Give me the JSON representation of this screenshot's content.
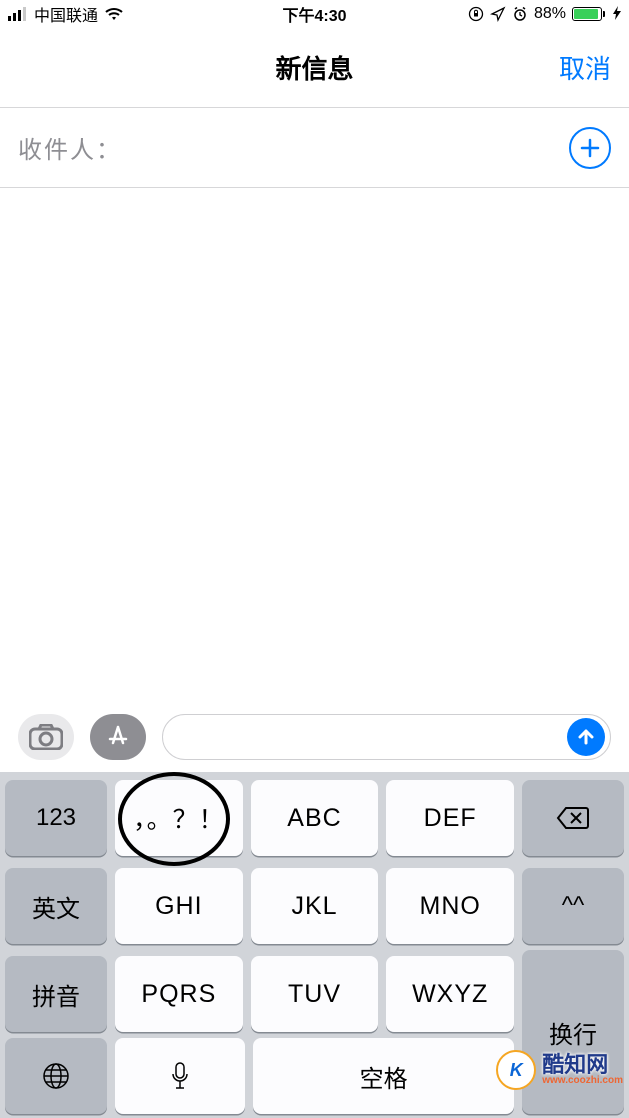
{
  "status": {
    "carrier": "中国联通",
    "time": "下午4:30",
    "battery_pct": "88%"
  },
  "header": {
    "title": "新信息",
    "cancel": "取消"
  },
  "recipient": {
    "label": "收件人："
  },
  "message_input": {
    "placeholder": ""
  },
  "keyboard": {
    "row1": {
      "side": "123",
      "k1": "，。？！",
      "k2": "ABC",
      "k3": "DEF",
      "back": "⌫"
    },
    "row2": {
      "side": "英文",
      "k1": "GHI",
      "k2": "JKL",
      "k3": "MNO",
      "emo": "^^"
    },
    "row3": {
      "side": "拼音",
      "k1": "PQRS",
      "k2": "TUV",
      "k3": "WXYZ",
      "enter": "换行"
    },
    "bottom": {
      "space": "空格",
      "enter": "换行"
    }
  },
  "watermark": {
    "cn": "酷知网",
    "en": "www.coozhi.com",
    "logo": "K"
  }
}
